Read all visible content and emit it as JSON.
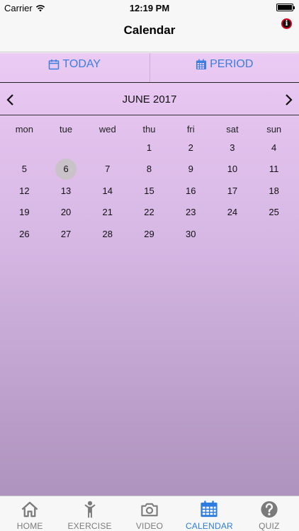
{
  "status": {
    "carrier": "Carrier",
    "time": "12:19 PM"
  },
  "header": {
    "title": "Calendar",
    "info_icon": "info-icon"
  },
  "tabs": [
    {
      "label": "TODAY",
      "icon": "calendar-icon"
    },
    {
      "label": "PERIOD",
      "icon": "calendar-grid-icon"
    }
  ],
  "calendar": {
    "month_label": "JUNE 2017",
    "weekdays": [
      "mon",
      "tue",
      "wed",
      "thu",
      "fri",
      "sat",
      "sun"
    ],
    "leading_blanks": 3,
    "days": [
      "1",
      "2",
      "3",
      "4",
      "5",
      "6",
      "7",
      "8",
      "9",
      "10",
      "11",
      "12",
      "13",
      "14",
      "15",
      "16",
      "17",
      "18",
      "19",
      "20",
      "21",
      "22",
      "23",
      "24",
      "25",
      "26",
      "27",
      "28",
      "29",
      "30"
    ],
    "selected_day": "6"
  },
  "tabbar": {
    "items": [
      {
        "label": "HOME",
        "icon": "home-icon",
        "active": false
      },
      {
        "label": "EXERCISE",
        "icon": "person-icon",
        "active": false
      },
      {
        "label": "VIDEO",
        "icon": "camera-icon",
        "active": false
      },
      {
        "label": "CALENDAR",
        "icon": "calendar-icon",
        "active": true
      },
      {
        "label": "QUIZ",
        "icon": "question-icon",
        "active": false
      }
    ]
  },
  "colors": {
    "accent": "#2d7ce0",
    "inactive": "#7b7b7b",
    "selected_day_bg": "#c9c3c9"
  }
}
